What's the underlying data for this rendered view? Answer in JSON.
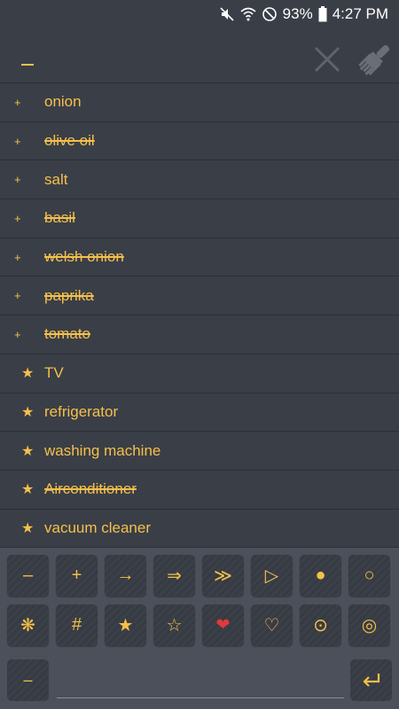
{
  "status_bar": {
    "battery": "93%",
    "time": "4:27 PM",
    "icons": [
      "mute-icon",
      "wifi-icon",
      "dnd-icon",
      "battery-icon"
    ]
  },
  "header": {
    "collapse_symbol": "–",
    "icons": [
      "clear-icon",
      "paintbrush-icon"
    ]
  },
  "list": {
    "items": [
      {
        "bullet": "+",
        "text": "onion",
        "done": false
      },
      {
        "bullet": "+",
        "text": "olive oil",
        "done": true
      },
      {
        "bullet": "+",
        "text": "salt",
        "done": false
      },
      {
        "bullet": "+",
        "text": "basil",
        "done": true
      },
      {
        "bullet": "+",
        "text": "welsh onion",
        "done": true
      },
      {
        "bullet": "+",
        "text": "paprika",
        "done": true
      },
      {
        "bullet": "+",
        "text": "tomato",
        "done": true
      },
      {
        "bullet": "★",
        "text": "TV",
        "done": false
      },
      {
        "bullet": "★",
        "text": "refrigerator",
        "done": false
      },
      {
        "bullet": "★",
        "text": "washing machine",
        "done": false
      },
      {
        "bullet": "★",
        "text": "Airconditioner",
        "done": true
      },
      {
        "bullet": "★",
        "text": "vacuum cleaner",
        "done": false
      }
    ]
  },
  "keyboard": {
    "row1": [
      "–",
      "+",
      "→",
      "⇒",
      "≫",
      "▷",
      "●",
      "○"
    ],
    "row2": [
      "❋",
      "#",
      "★",
      "☆",
      "❤",
      "♡",
      "⊙",
      "◎"
    ],
    "mode_key": "–",
    "input_value": "",
    "enter_icon": "enter-icon"
  },
  "colors": {
    "accent": "#f5c04a",
    "background": "#3a3e47",
    "keyboard_bg": "#4c505a",
    "heart": "#e23a3a"
  }
}
